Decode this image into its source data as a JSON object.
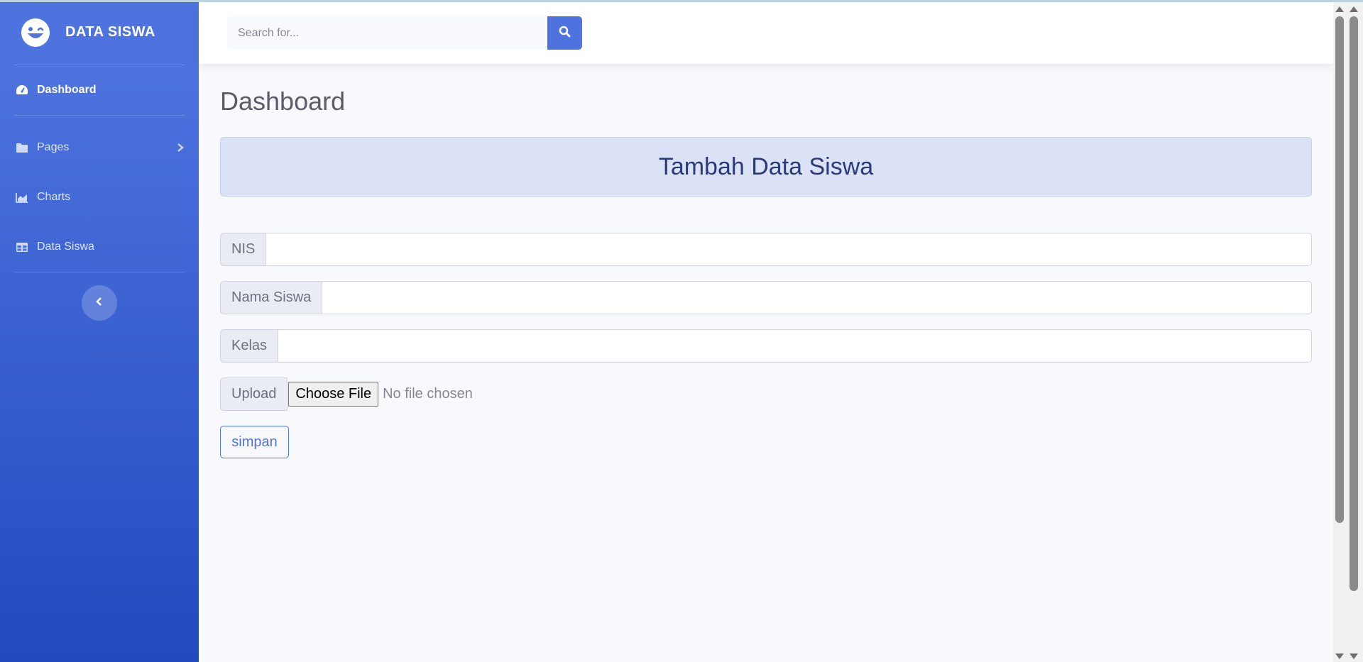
{
  "brand": {
    "title": "DATA SISWA",
    "logo_icon": "laugh-wink-icon"
  },
  "sidebar": {
    "items": [
      {
        "label": "Dashboard",
        "icon": "tachometer-icon",
        "active": true
      },
      {
        "label": "Pages",
        "icon": "folder-icon",
        "has_submenu": true
      },
      {
        "label": "Charts",
        "icon": "chart-area-icon"
      },
      {
        "label": "Data Siswa",
        "icon": "table-icon"
      }
    ],
    "toggle_icon": "chevron-left-icon"
  },
  "topbar": {
    "search_placeholder": "Search for...",
    "search_icon": "search-icon"
  },
  "main": {
    "page_title": "Dashboard",
    "card_title": "Tambah Data Siswa",
    "form": {
      "nis_label": "NIS",
      "nama_label": "Nama Siswa",
      "kelas_label": "Kelas",
      "upload_label": "Upload",
      "file_button": "Choose File",
      "file_status": "No file chosen",
      "submit_label": "simpan"
    }
  },
  "colors": {
    "primary": "#4e73df",
    "sidebar_end": "#224abe",
    "card_bg": "#dbe2f6",
    "body_bg": "#f8f9fc"
  }
}
